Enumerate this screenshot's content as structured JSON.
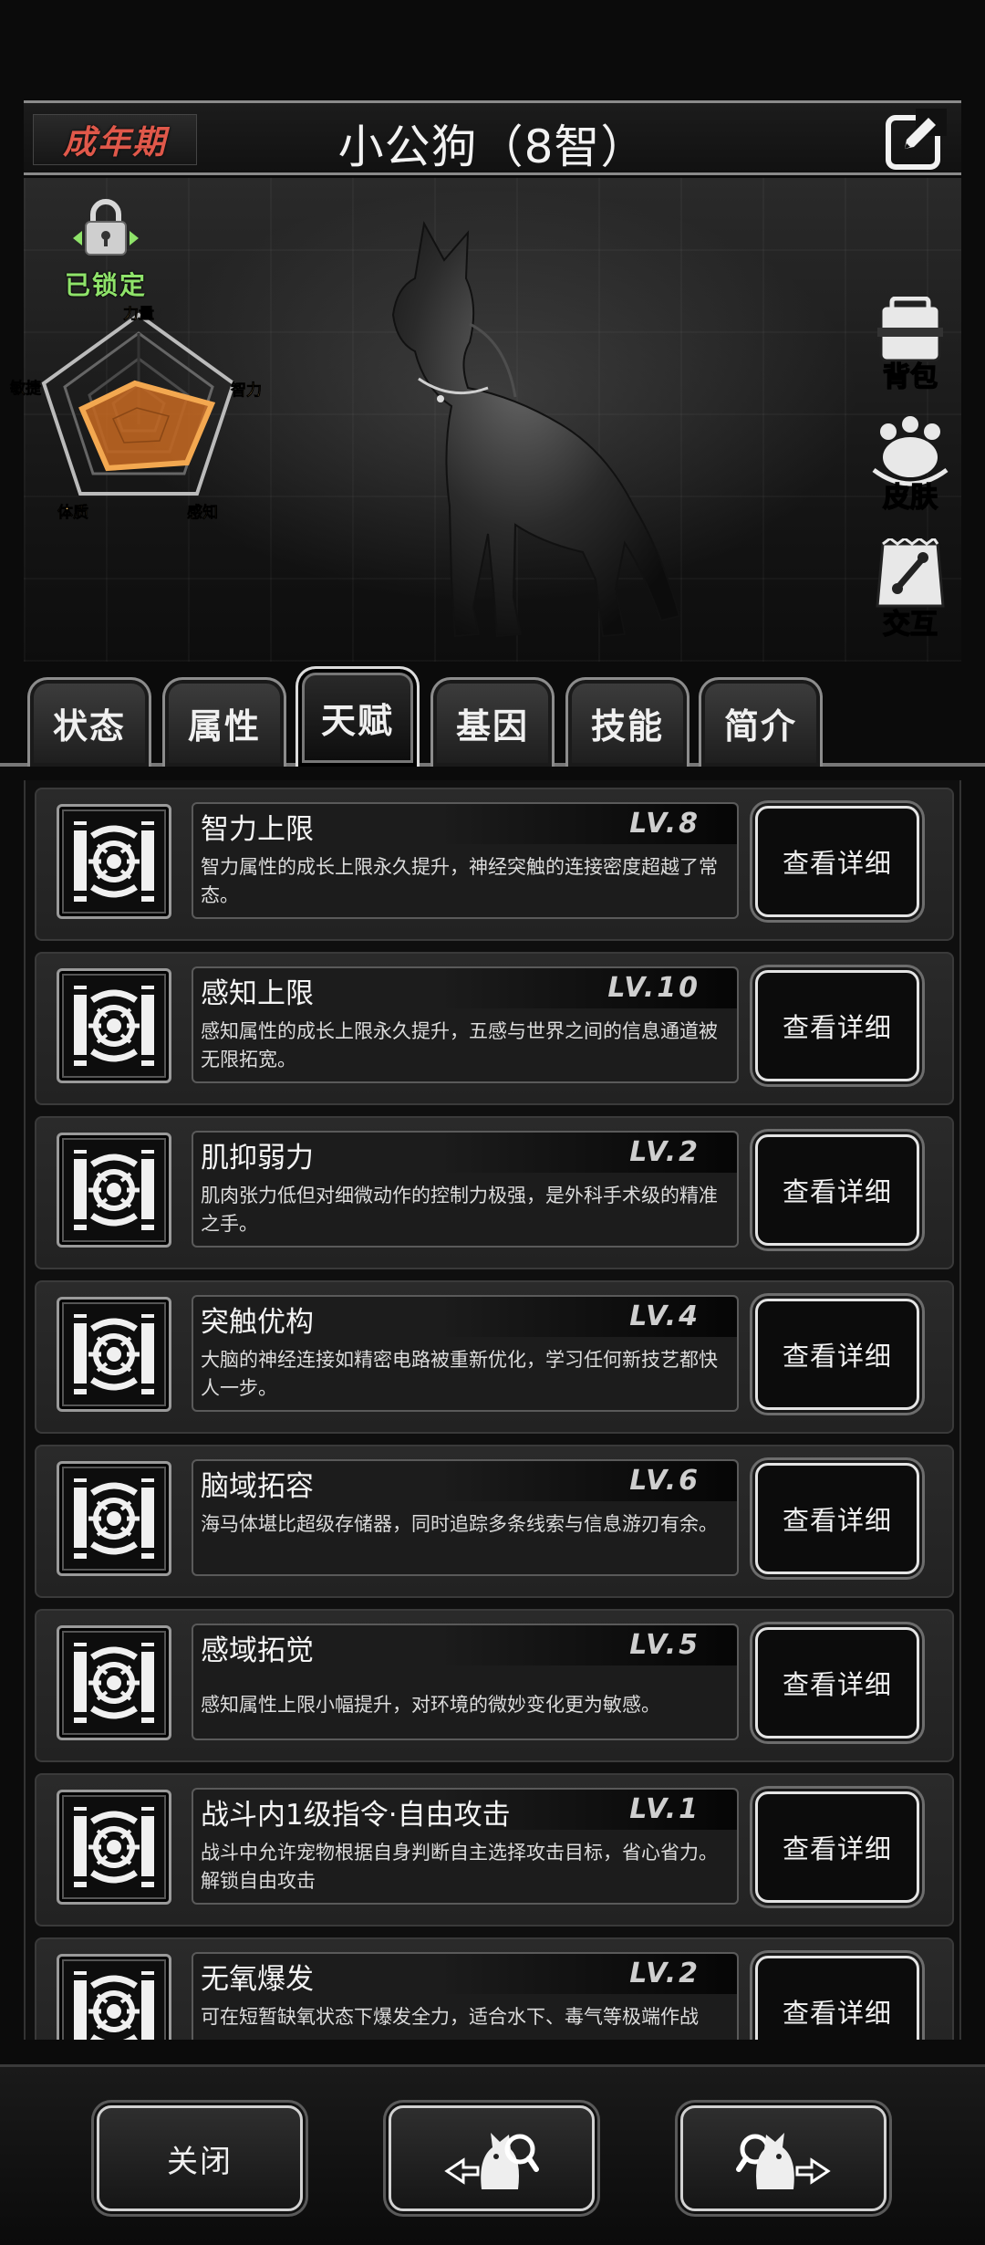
{
  "header": {
    "stage": "成年期",
    "pet_name": "小公狗（8智）"
  },
  "lock": {
    "label": "已锁定"
  },
  "radar": {
    "labels": {
      "top": "力量",
      "right": "智力",
      "bottom_right": "感知",
      "bottom_left": "体质",
      "left": "敏捷"
    }
  },
  "side_buttons": {
    "bag": "背包",
    "skin": "皮肤",
    "interact": "交互"
  },
  "tabs": [
    {
      "label": "状态"
    },
    {
      "label": "属性"
    },
    {
      "label": "天赋"
    },
    {
      "label": "基因"
    },
    {
      "label": "技能"
    },
    {
      "label": "简介"
    }
  ],
  "active_tab": "天赋",
  "talents": [
    {
      "title": "智力上限",
      "level": "LV.8",
      "desc": "智力属性的成长上限永久提升，神经突触的连接密度超越了常态。"
    },
    {
      "title": "感知上限",
      "level": "LV.10",
      "desc": "感知属性的成长上限永久提升，五感与世界之间的信息通道被无限拓宽。"
    },
    {
      "title": "肌抑弱力",
      "level": "LV.2",
      "desc": "肌肉张力低但对细微动作的控制力极强，是外科手术级的精准之手。"
    },
    {
      "title": "突触优构",
      "level": "LV.4",
      "desc": "大脑的神经连接如精密电路被重新优化，学习任何新技艺都快人一步。"
    },
    {
      "title": "脑域拓容",
      "level": "LV.6",
      "desc": "海马体堪比超级存储器，同时追踪多条线索与信息游刃有余。"
    },
    {
      "title": "感域拓觉",
      "level": "LV.5",
      "desc": "感知属性上限小幅提升，对环境的微妙变化更为敏感。"
    },
    {
      "title": "战斗内1级指令·自由攻击",
      "level": "LV.1",
      "desc": "战斗中允许宠物根据自身判断自主选择攻击目标，省心省力。解锁自由攻击"
    },
    {
      "title": "无氧爆发",
      "level": "LV.2",
      "desc": "可在短暂缺氧状态下爆发全力，适合水下、毒气等极端作战"
    }
  ],
  "detail_label": "查看详细",
  "footer": {
    "close": "关闭"
  }
}
